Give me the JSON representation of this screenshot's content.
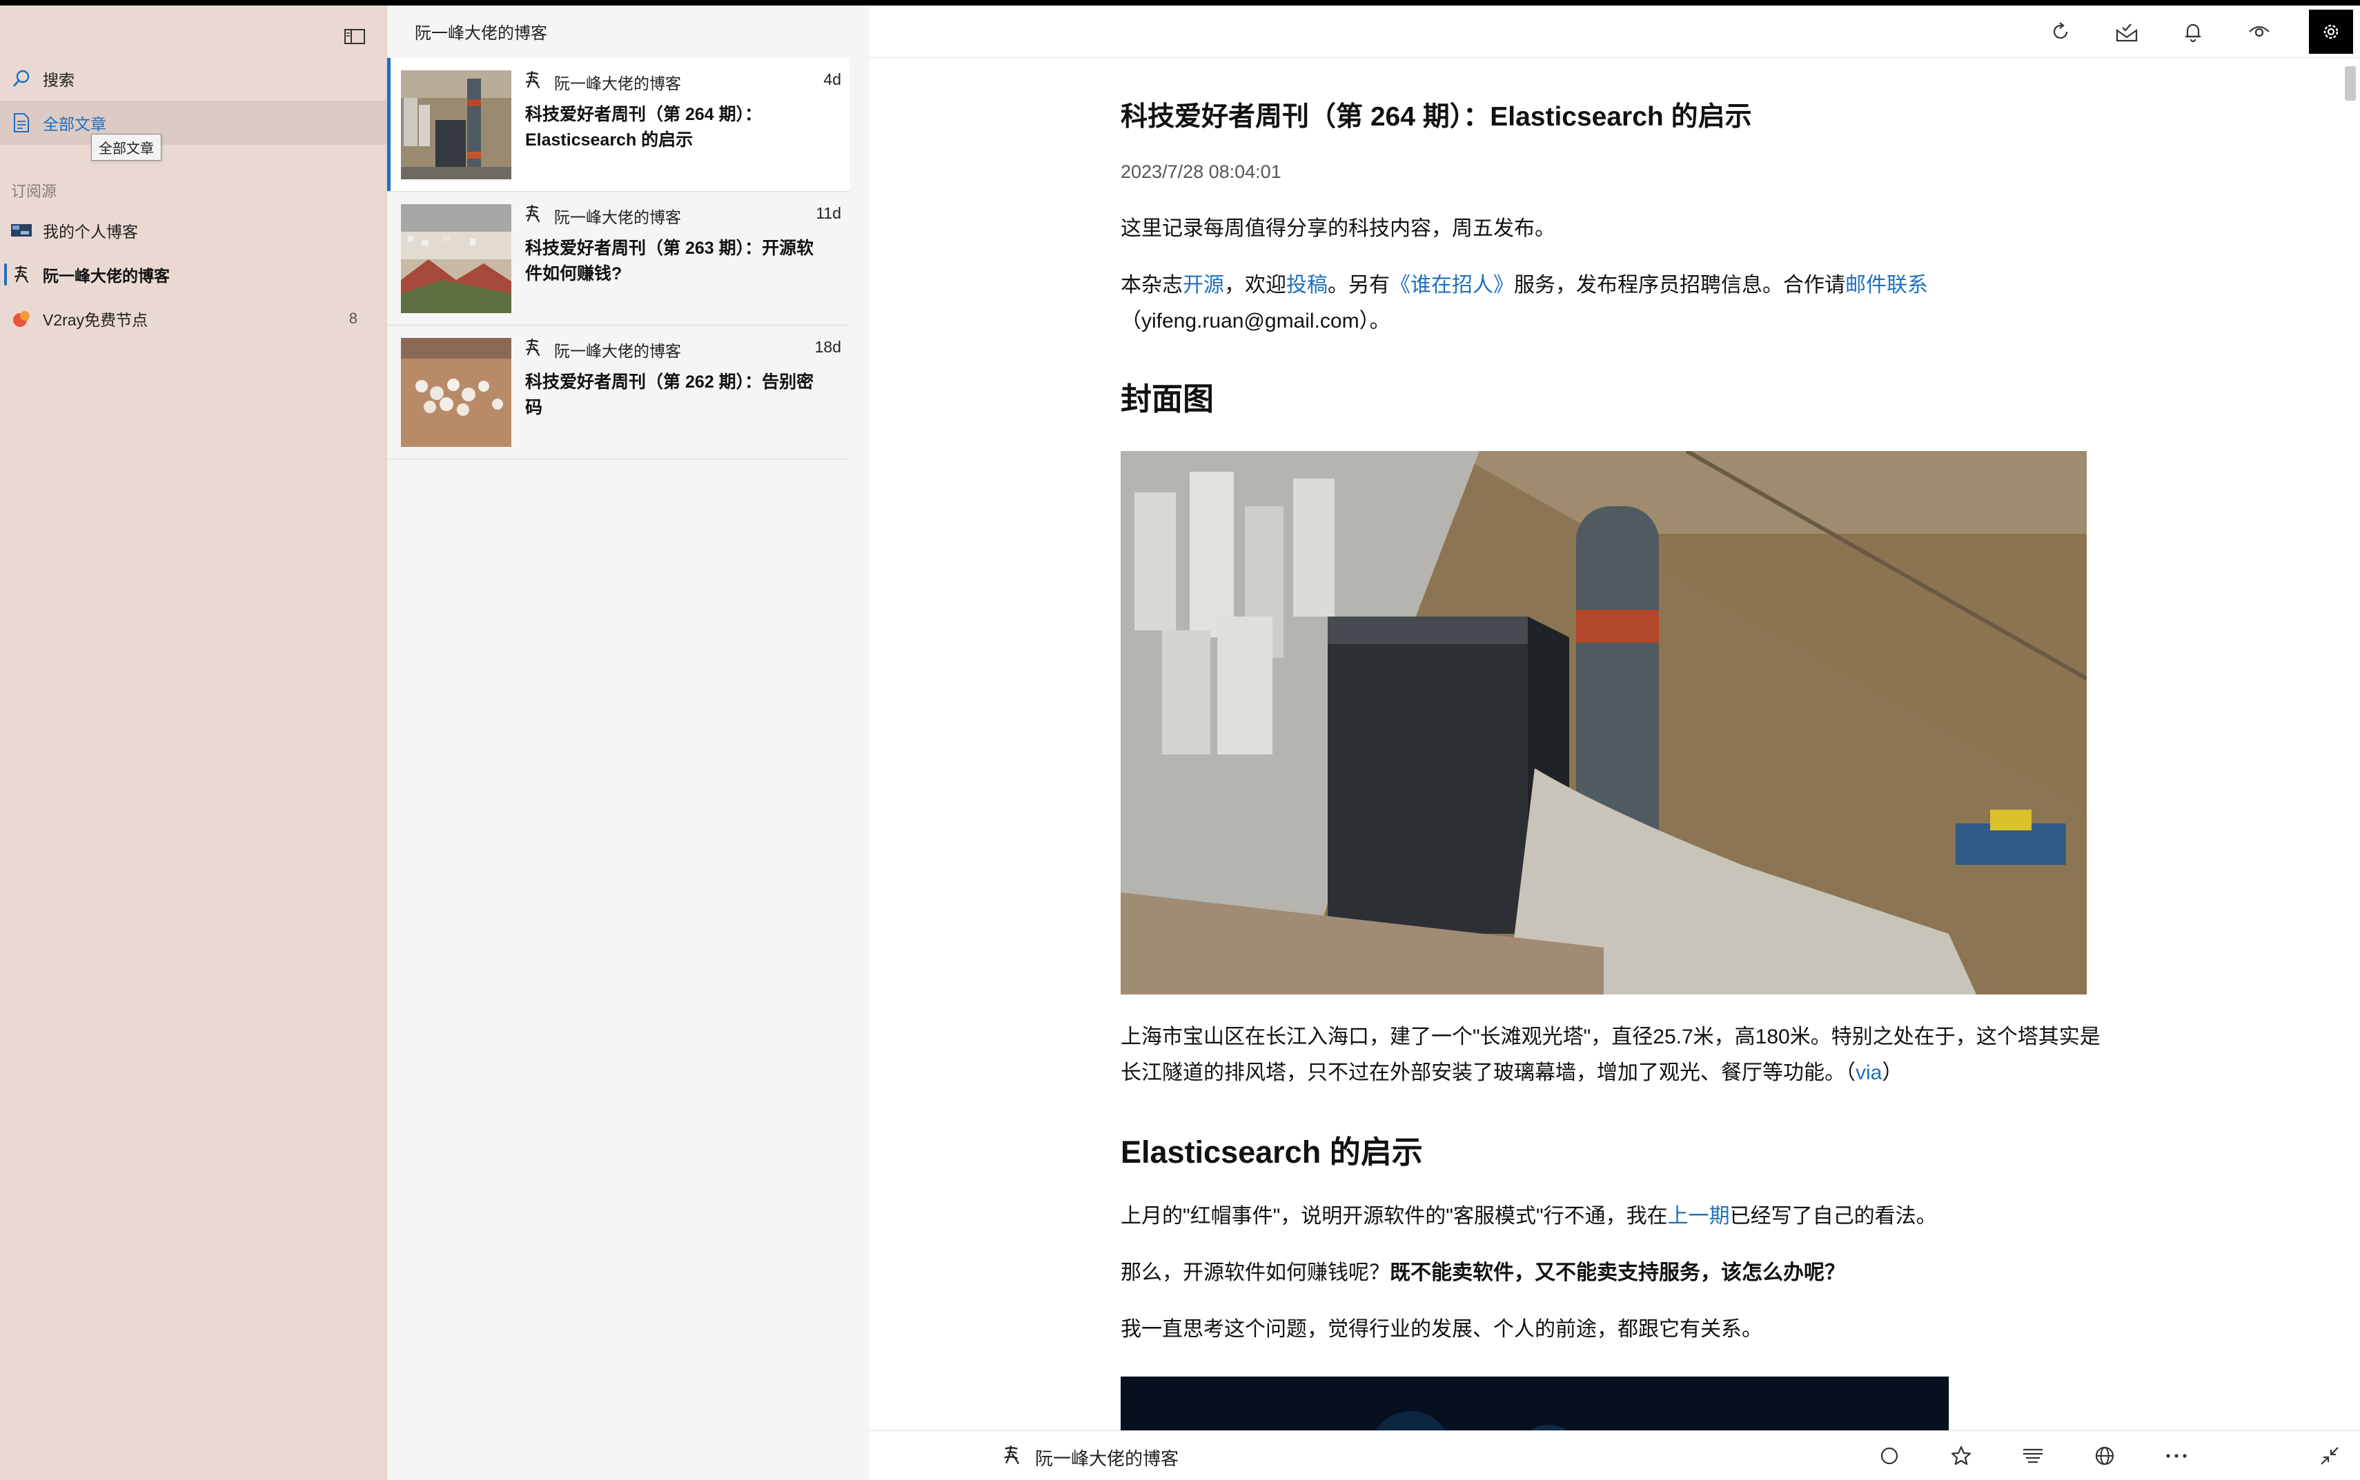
{
  "sidebar": {
    "search_label": "搜索",
    "all_articles_label": "全部文章",
    "tooltip": "全部文章",
    "section_label": "订阅源",
    "feeds": [
      {
        "label": "我的个人博客",
        "count": ""
      },
      {
        "label": "阮一峰大佬的博客",
        "count": ""
      },
      {
        "label": "V2ray免费节点",
        "count": "8"
      }
    ]
  },
  "list": {
    "title": "阮一峰大佬的博客",
    "items": [
      {
        "source": "阮一峰大佬的博客",
        "age": "4d",
        "title": "科技爱好者周刊（第 264 期）：Elasticsearch 的启示"
      },
      {
        "source": "阮一峰大佬的博客",
        "age": "11d",
        "title": "科技爱好者周刊（第 263 期）：开源软件如何赚钱?"
      },
      {
        "source": "阮一峰大佬的博客",
        "age": "18d",
        "title": "科技爱好者周刊（第 262 期）：告别密码"
      }
    ]
  },
  "toolbar": {
    "icons": [
      "refresh-icon",
      "mark-all-read-icon",
      "notifications-icon",
      "view-icon",
      "settings-icon"
    ]
  },
  "article": {
    "title": "科技爱好者周刊（第 264 期）：Elasticsearch 的启示",
    "date": "2023/7/28 08:04:01",
    "intro": "这里记录每周值得分享的科技内容，周五发布。",
    "p2": {
      "t1": "本杂志",
      "l1": "开源",
      "t2": "，欢迎",
      "l2": "投稿",
      "t3": "。另有",
      "l3": "《谁在招人》",
      "t4": "服务，发布程序员招聘信息。合作请",
      "l4": "邮件联系",
      "t5": "（yifeng.ruan@gmail.com）。"
    },
    "h_cover": "封面图",
    "caption": {
      "text": "上海市宝山区在长江入海口，建了一个\"长滩观光塔\"，直径25.7米，高180米。特别之处在于，这个塔其实是长江隧道的排风塔，只不过在外部安装了玻璃幕墙，增加了观光、餐厅等功能。（",
      "link": "via",
      "end": "）"
    },
    "h_section": "Elasticsearch 的启示",
    "p3": {
      "t1": "上月的\"红帽事件\"，说明开源软件的\"客服模式\"行不通，我在",
      "link": "上一期",
      "t2": "已经写了自己的看法。"
    },
    "p4": {
      "t1": "那么，开源软件如何赚钱呢？",
      "bold": "既不能卖软件，又不能卖支持服务，该怎么办呢？"
    },
    "p5": "我一直思考这个问题，觉得行业的发展、个人的前途，都跟它有关系。"
  },
  "bottom_bar": {
    "source": "阮一峰大佬的博客",
    "icons": [
      "mark-unread-icon",
      "star-icon",
      "reader-view-icon",
      "open-in-browser-icon",
      "more-icon",
      "collapse-icon"
    ]
  },
  "colors": {
    "sidebar_bg": "#ead9d3",
    "accent": "#1f6fbf",
    "list_bg": "#f6f5f5"
  }
}
